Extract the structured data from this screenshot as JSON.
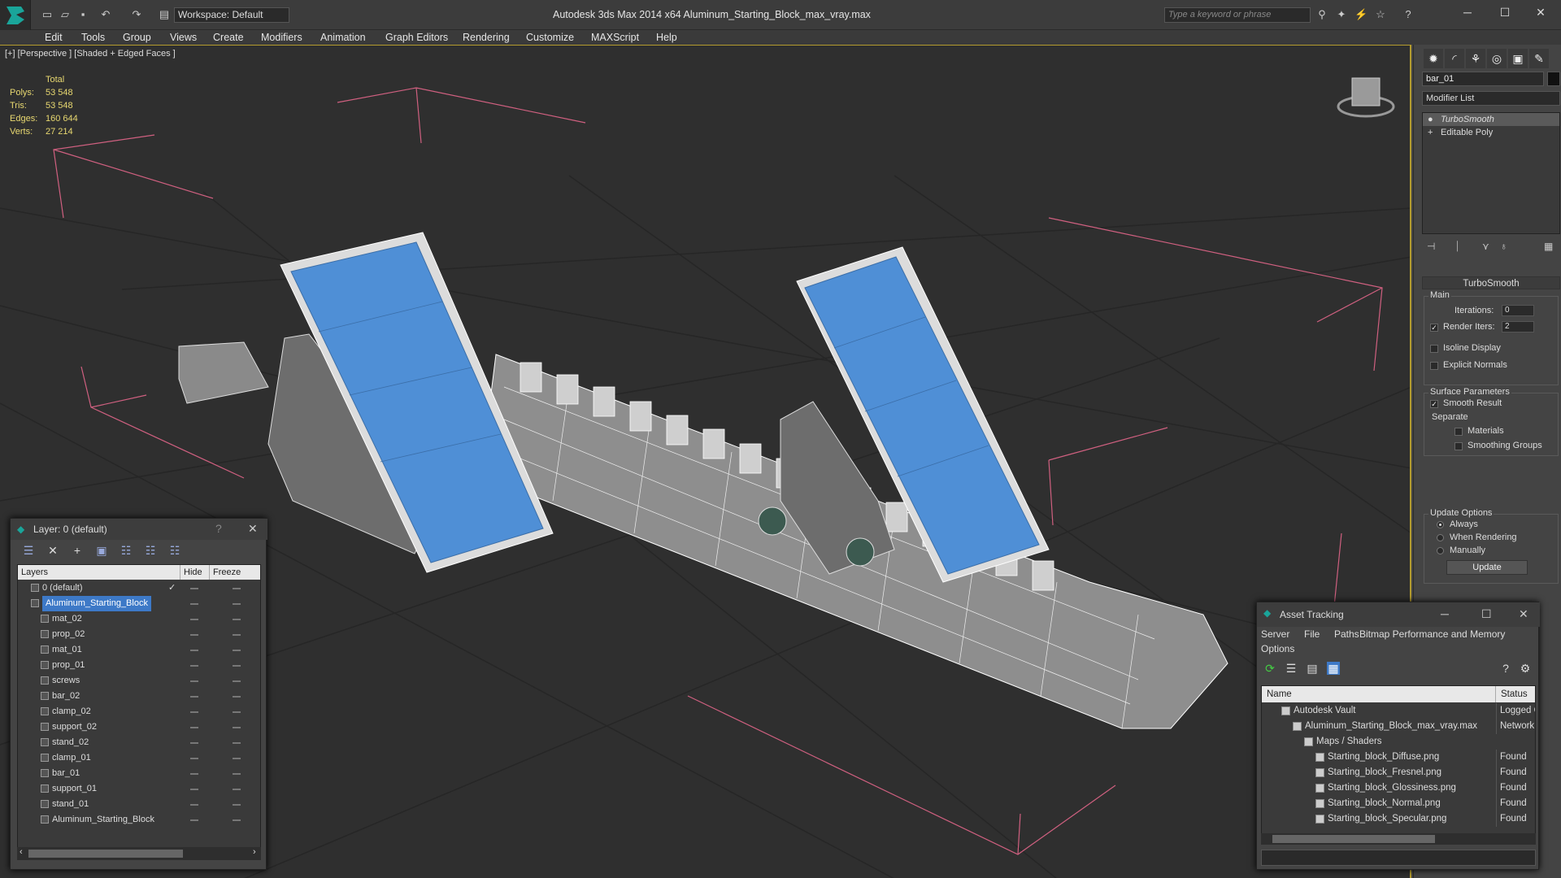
{
  "titlebar": {
    "workspace": "Workspace: Default",
    "title": "Autodesk 3ds Max  2014 x64      Aluminum_Starting_Block_max_vray.max",
    "search_placeholder": "Type a keyword or phrase"
  },
  "menu": [
    "Edit",
    "Tools",
    "Group",
    "Views",
    "Create",
    "Modifiers",
    "Animation",
    "Graph Editors",
    "Rendering",
    "Customize",
    "MAXScript",
    "Help"
  ],
  "viewport": {
    "label": "[+] [Perspective ] [Shaded + Edged Faces ]",
    "stats": {
      "header": "Total",
      "polys_label": "Polys:",
      "polys": "53 548",
      "tris_label": "Tris:",
      "tris": "53 548",
      "edges_label": "Edges:",
      "edges": "160 644",
      "verts_label": "Verts:",
      "verts": "27 214"
    }
  },
  "command_panel": {
    "object_name": "bar_01",
    "modifier_list": "Modifier List",
    "stack": [
      "TurboSmooth",
      "Editable Poly"
    ],
    "turbosmooth": {
      "title": "TurboSmooth",
      "main_label": "Main",
      "iterations_label": "Iterations:",
      "iterations": "0",
      "render_iters_label": "Render Iters:",
      "render_iters": "2",
      "isoline": "Isoline Display",
      "explicit_normals": "Explicit Normals",
      "surface_params": "Surface Parameters",
      "smooth_result": "Smooth Result",
      "separate": "Separate",
      "materials": "Materials",
      "smoothing_groups": "Smoothing Groups",
      "update_options": "Update Options",
      "always": "Always",
      "when_rendering": "When Rendering",
      "manually": "Manually",
      "update_button": "Update"
    }
  },
  "layers_window": {
    "title": "Layer: 0 (default)",
    "help": "?",
    "columns": [
      "Layers",
      "Hide",
      "Freeze"
    ],
    "rows": [
      {
        "name": "0 (default)",
        "indent": 0
      },
      {
        "name": "Aluminum_Starting_Block",
        "indent": 0,
        "selected": true
      },
      {
        "name": "mat_02",
        "indent": 1
      },
      {
        "name": "prop_02",
        "indent": 1
      },
      {
        "name": "mat_01",
        "indent": 1
      },
      {
        "name": "prop_01",
        "indent": 1
      },
      {
        "name": "screws",
        "indent": 1
      },
      {
        "name": "bar_02",
        "indent": 1
      },
      {
        "name": "clamp_02",
        "indent": 1
      },
      {
        "name": "support_02",
        "indent": 1
      },
      {
        "name": "stand_02",
        "indent": 1
      },
      {
        "name": "clamp_01",
        "indent": 1
      },
      {
        "name": "bar_01",
        "indent": 1
      },
      {
        "name": "support_01",
        "indent": 1
      },
      {
        "name": "stand_01",
        "indent": 1
      },
      {
        "name": "Aluminum_Starting_Block",
        "indent": 1
      }
    ]
  },
  "asset_window": {
    "title": "Asset Tracking",
    "menu": [
      "Server",
      "File",
      "Paths",
      "Bitmap Performance and Memory",
      "Options"
    ],
    "columns": [
      "Name",
      "Status"
    ],
    "rows": [
      {
        "name": "Autodesk Vault",
        "status": "Logged O",
        "indent": 1
      },
      {
        "name": "Aluminum_Starting_Block_max_vray.max",
        "status": "Network",
        "indent": 2
      },
      {
        "name": "Maps / Shaders",
        "status": "",
        "indent": 3
      },
      {
        "name": "Starting_block_Diffuse.png",
        "status": "Found",
        "indent": 4
      },
      {
        "name": "Starting_block_Fresnel.png",
        "status": "Found",
        "indent": 4
      },
      {
        "name": "Starting_block_Glossiness.png",
        "status": "Found",
        "indent": 4
      },
      {
        "name": "Starting_block_Normal.png",
        "status": "Found",
        "indent": 4
      },
      {
        "name": "Starting_block_Specular.png",
        "status": "Found",
        "indent": 4
      }
    ]
  },
  "colors": {
    "selection": "#3d79c7",
    "viewport_border": "#b39b2e",
    "stats": "#e8d870",
    "pad_blue": "#4f8fd6",
    "bbox_pink": "#d06080"
  }
}
